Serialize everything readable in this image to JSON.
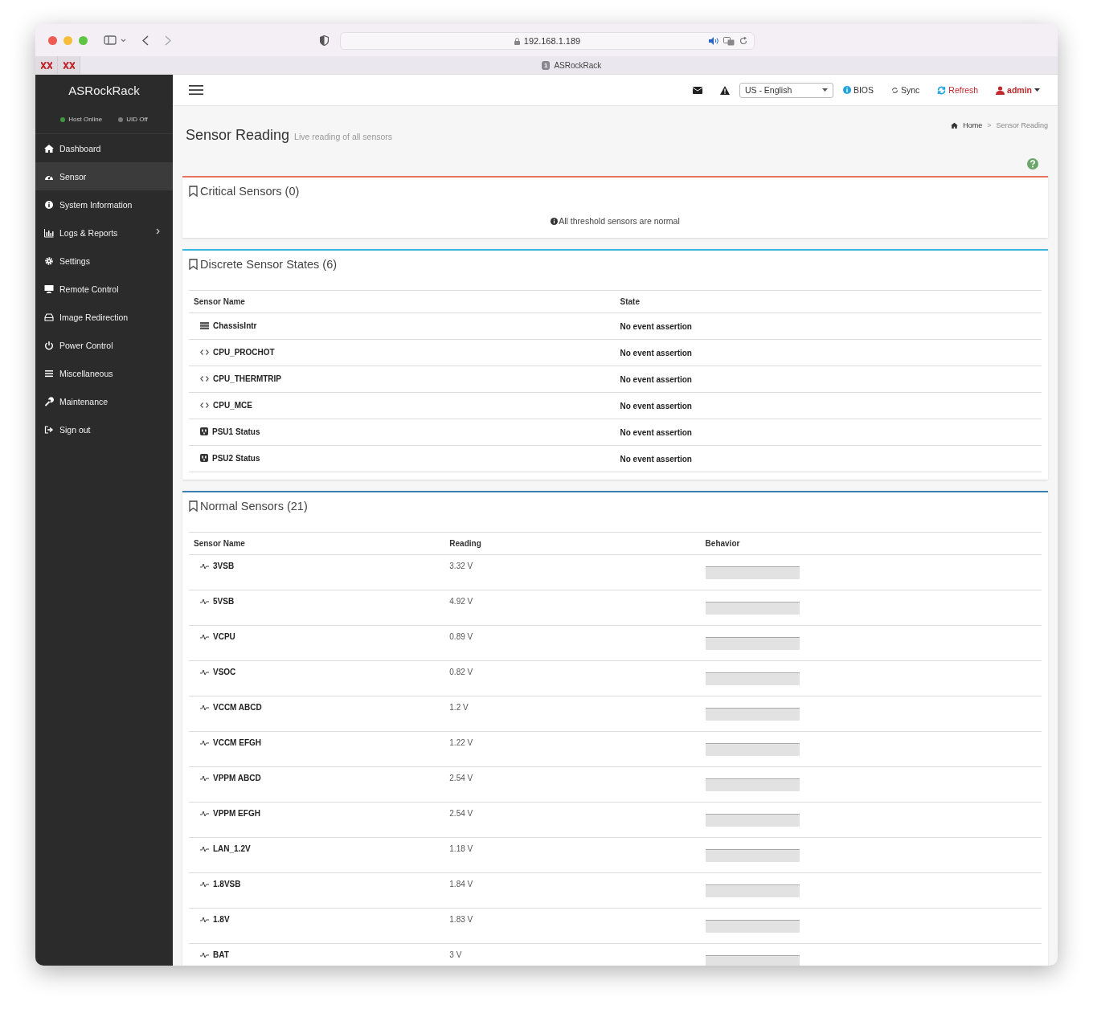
{
  "browser": {
    "address": "192.168.1.189",
    "pinned_tabs": [
      {
        "kind": "site"
      },
      {
        "kind": "site"
      }
    ],
    "tab": {
      "badge": "1",
      "title": "ASRockRack"
    }
  },
  "sidebar": {
    "brand": "ASRockRack",
    "status": [
      {
        "label": "Host Online",
        "color": "#3f9a3f"
      },
      {
        "label": "UID Off",
        "color": "#7a7a7a"
      }
    ],
    "items": [
      {
        "label": "Dashboard",
        "selected": false,
        "submenu": false
      },
      {
        "label": "Sensor",
        "selected": true,
        "submenu": false
      },
      {
        "label": "System Information",
        "selected": false,
        "submenu": false
      },
      {
        "label": "Logs & Reports",
        "selected": false,
        "submenu": true
      },
      {
        "label": "Settings",
        "selected": false,
        "submenu": false
      },
      {
        "label": "Remote Control",
        "selected": false,
        "submenu": false
      },
      {
        "label": "Image Redirection",
        "selected": false,
        "submenu": false
      },
      {
        "label": "Power Control",
        "selected": false,
        "submenu": false
      },
      {
        "label": "Miscellaneous",
        "selected": false,
        "submenu": false
      },
      {
        "label": "Maintenance",
        "selected": false,
        "submenu": false
      },
      {
        "label": "Sign out",
        "selected": false,
        "submenu": false
      }
    ]
  },
  "topbar": {
    "language": "US - English",
    "actions": [
      {
        "kind": "bios",
        "label": "BIOS"
      },
      {
        "kind": "sync",
        "label": "Sync"
      },
      {
        "kind": "refresh",
        "label": "Refresh"
      },
      {
        "kind": "user",
        "label": "admin"
      }
    ]
  },
  "page": {
    "title": "Sensor Reading",
    "subtitle": "Live reading of all sensors",
    "breadcrumb": {
      "home": "Home",
      "separator": ">",
      "current": "Sensor Reading"
    }
  },
  "panels": [
    {
      "kind": "message",
      "title": "Critical Sensors (0)",
      "color": "#e8765e",
      "message": "All threshold sensors are normal"
    },
    {
      "kind": "states",
      "title": "Discrete Sensor States (6)",
      "color": "#3db6de",
      "columns": [
        "Sensor Name",
        "State"
      ],
      "rows": [
        {
          "kind": "chassis",
          "name": "ChassisIntr",
          "state": "No event assertion"
        },
        {
          "kind": "signal",
          "name": "CPU_PROCHOT",
          "state": "No event assertion"
        },
        {
          "kind": "signal",
          "name": "CPU_THERMTRIP",
          "state": "No event assertion"
        },
        {
          "kind": "signal",
          "name": "CPU_MCE",
          "state": "No event assertion"
        },
        {
          "kind": "psu",
          "name": "PSU1 Status",
          "state": "No event assertion"
        },
        {
          "kind": "psu",
          "name": "PSU2 Status",
          "state": "No event assertion"
        }
      ]
    },
    {
      "kind": "readings",
      "title": "Normal Sensors (21)",
      "color": "#3b80b3",
      "columns": [
        "Sensor Name",
        "Reading",
        "Behavior"
      ],
      "rows": [
        {
          "name": "3VSB",
          "reading": "3.32 V"
        },
        {
          "name": "5VSB",
          "reading": "4.92 V"
        },
        {
          "name": "VCPU",
          "reading": "0.89 V"
        },
        {
          "name": "VSOC",
          "reading": "0.82 V"
        },
        {
          "name": "VCCM ABCD",
          "reading": "1.2 V"
        },
        {
          "name": "VCCM EFGH",
          "reading": "1.22 V"
        },
        {
          "name": "VPPM ABCD",
          "reading": "2.54 V"
        },
        {
          "name": "VPPM EFGH",
          "reading": "2.54 V"
        },
        {
          "name": "LAN_1.2V",
          "reading": "1.18 V"
        },
        {
          "name": "1.8VSB",
          "reading": "1.84 V"
        },
        {
          "name": "1.8V",
          "reading": "1.83 V"
        },
        {
          "name": "BAT",
          "reading": "3 V"
        }
      ]
    }
  ]
}
